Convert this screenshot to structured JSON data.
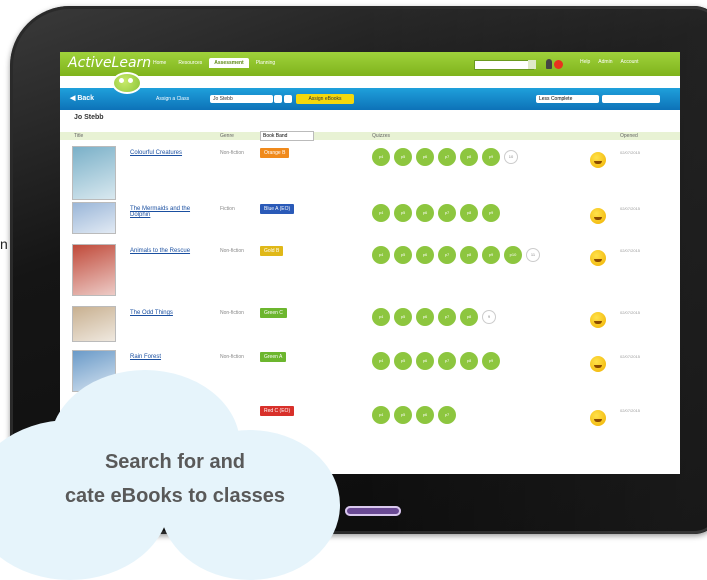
{
  "app": {
    "brand": "ActiveLearn",
    "nav_tabs": [
      "Home",
      "Resources",
      "Assessment",
      "Planning"
    ],
    "active_tab": "Assessment",
    "top_links": [
      "Help",
      "Admin",
      "Account"
    ]
  },
  "toolbar": {
    "back_label": "Back",
    "assign_label": "Assign a Class",
    "class_value": "Jo Stebb",
    "assign_button": "Assign eBooks",
    "filter_value": "Less Complete"
  },
  "class_name": "Jo Stebb",
  "table": {
    "headers": [
      "Title",
      "Genre",
      "Quizzes",
      "Opened"
    ],
    "sort_value": "Book Band"
  },
  "books": [
    {
      "title": "Colourful Creatures",
      "genre": "Non-fiction",
      "band": "Orange B",
      "band_color": "#f08a1c",
      "quizzes": [
        "p4",
        "p5",
        "p6",
        "p7",
        "p8",
        "p9"
      ],
      "extra": "10",
      "date": "02/07/2015",
      "cover_color": "#7ab0c8"
    },
    {
      "title": "The Mermaids and the Dolphin",
      "genre": "Fiction",
      "band": "Blue A (EO)",
      "band_color": "#2a5ab8",
      "quizzes": [
        "p4",
        "p5",
        "p6",
        "p7",
        "p8",
        "p9"
      ],
      "extra": "",
      "date": "02/07/2015",
      "cover_color": "#9ab6d8"
    },
    {
      "title": "Animals to the Rescue",
      "genre": "Non-fiction",
      "band": "Gold B",
      "band_color": "#e0b818",
      "quizzes": [
        "p4",
        "p5",
        "p6",
        "p7",
        "p8",
        "p9",
        "p10"
      ],
      "extra": "11",
      "date": "02/07/2015",
      "cover_color": "#c04a3a"
    },
    {
      "title": "The Odd Things",
      "genre": "Non-fiction",
      "band": "Green C",
      "band_color": "#6cb62e",
      "quizzes": [
        "p4",
        "p5",
        "p6",
        "p7",
        "p8"
      ],
      "extra": "9",
      "date": "02/07/2015",
      "cover_color": "#c8b090"
    },
    {
      "title": "Rain Forest",
      "genre": "Non-fiction",
      "band": "Green A",
      "band_color": "#6cb62e",
      "quizzes": [
        "p4",
        "p5",
        "p6",
        "p7",
        "p8",
        "p9"
      ],
      "extra": "",
      "date": "02/07/2015",
      "cover_color": "#6a9ac8"
    },
    {
      "title": "",
      "genre": "",
      "band": "Red C (EO)",
      "band_color": "#d8302a",
      "quizzes": [
        "p4",
        "p5",
        "p6",
        "p7"
      ],
      "extra": "",
      "date": "02/07/2015",
      "cover_color": "#e0e0e0"
    }
  ],
  "callout": {
    "line1": "Search for and",
    "line2": "cate eBooks to classes"
  },
  "side_letter": "n"
}
